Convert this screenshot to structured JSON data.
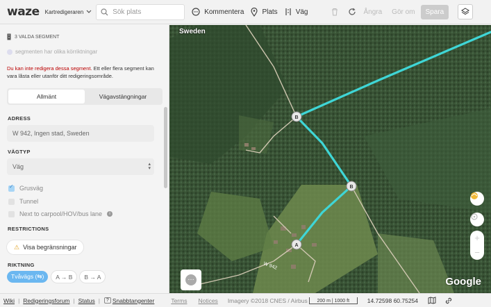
{
  "header": {
    "logo": "waze",
    "mode_label": "Kartredigeraren",
    "search_placeholder": "Sök plats",
    "tools": [
      {
        "label": "Kommentera",
        "icon": "comment-icon"
      },
      {
        "label": "Plats",
        "icon": "place-pin-icon"
      },
      {
        "label": "Väg",
        "icon": "road-icon"
      }
    ],
    "undo_label": "Ångra",
    "redo_label": "Gör om",
    "save_label": "Spara"
  },
  "sidebar": {
    "selected_header": "3 VALDA SEGMENT",
    "direction_note": "segmenten har olika körriktningar",
    "warning_red": "Du kan inte redigera dessa segment.",
    "warning_rest": " Ett eller flera segment kan vara låsta eller utanför ditt redigeringsområde.",
    "tabs": [
      "Allmänt",
      "Vägavstängningar"
    ],
    "address_label": "ADRESS",
    "address_value": "W 942, Ingen stad, Sweden",
    "roadtype_label": "VÄGTYP",
    "roadtype_value": "Väg",
    "checkboxes": [
      {
        "label": "Grusväg",
        "checked": true
      },
      {
        "label": "Tunnel",
        "checked": false
      },
      {
        "label": "Next to carpool/HOV/bus lane",
        "checked": false
      }
    ],
    "restrictions_label": "RESTRICTIONS",
    "restrictions_button": "Visa begränsningar",
    "direction_label": "RIKTNING",
    "direction_options": [
      "Tvåvägs (⇆)",
      "A → B",
      "B → A"
    ]
  },
  "map": {
    "country_label": "Sweden",
    "node_labels": [
      "B",
      "B",
      "A"
    ],
    "road_label": "W 942",
    "attribution": "Google",
    "colors": {
      "selected_segment": "#3fd6d6",
      "node": "#e8e8e8"
    }
  },
  "footer": {
    "links": [
      "Wiki",
      "Redigeringsforum",
      "Status"
    ],
    "shortcuts_key": "?",
    "shortcuts_label": "Snabbtangenter",
    "terms": "Terms",
    "notices": "Notices",
    "imagery": "Imagery ©2018 CNES / Airbus",
    "scale": "200 m | 1000 ft",
    "coordinates": "14.72598 60.75254"
  }
}
